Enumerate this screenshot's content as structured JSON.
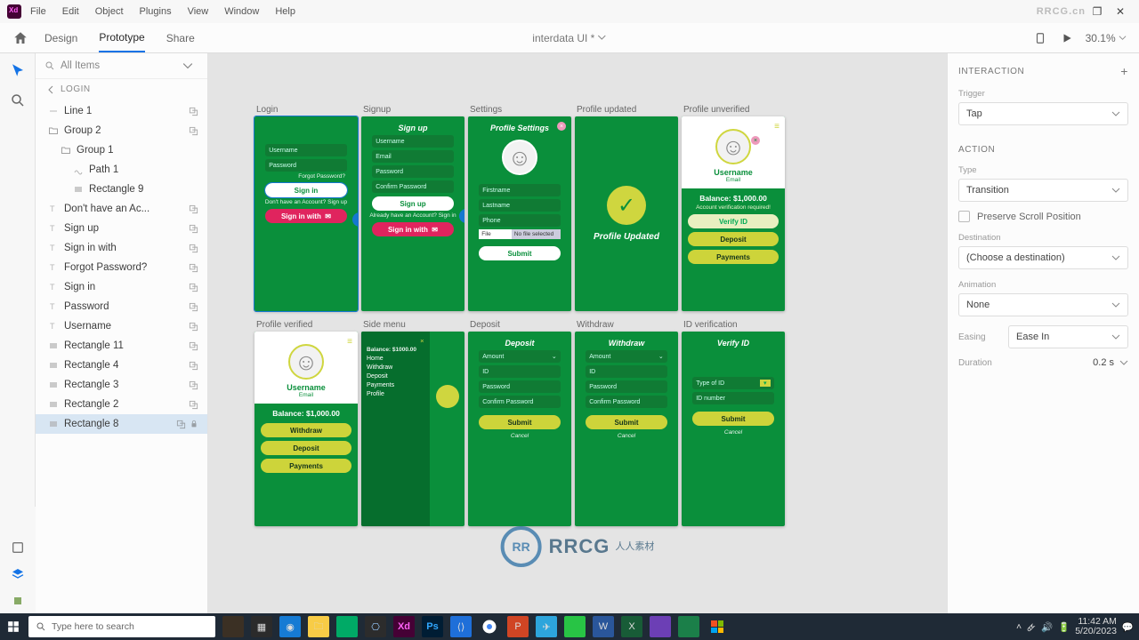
{
  "menubar": [
    "File",
    "Edit",
    "Object",
    "Plugins",
    "View",
    "Window",
    "Help"
  ],
  "watermark_tr": "RRCG.cn",
  "tabs": {
    "design": "Design",
    "prototype": "Prototype",
    "share": "Share"
  },
  "doc_title": "interdata UI *",
  "zoom": "30.1%",
  "left": {
    "search": "All Items",
    "back": "LOGIN",
    "layers": [
      {
        "name": "Line 1",
        "type": "line",
        "indent": 0,
        "link": true
      },
      {
        "name": "Group 2",
        "type": "folder",
        "indent": 0,
        "link": true
      },
      {
        "name": "Group 1",
        "type": "folder",
        "indent": 1
      },
      {
        "name": "Path 1",
        "type": "path",
        "indent": 2
      },
      {
        "name": "Rectangle 9",
        "type": "rect",
        "indent": 2
      },
      {
        "name": "Don't have an Ac...",
        "type": "text",
        "indent": 0,
        "link": true
      },
      {
        "name": "Sign up",
        "type": "text",
        "indent": 0,
        "link": true
      },
      {
        "name": "Sign in with",
        "type": "text",
        "indent": 0,
        "link": true
      },
      {
        "name": "Forgot Password?",
        "type": "text",
        "indent": 0,
        "link": true
      },
      {
        "name": "Sign in",
        "type": "text",
        "indent": 0,
        "link": true
      },
      {
        "name": "Password",
        "type": "text",
        "indent": 0,
        "link": true
      },
      {
        "name": "Username",
        "type": "text",
        "indent": 0,
        "link": true
      },
      {
        "name": "Rectangle 11",
        "type": "rect",
        "indent": 0,
        "link": true
      },
      {
        "name": "Rectangle 4",
        "type": "rect",
        "indent": 0,
        "link": true
      },
      {
        "name": "Rectangle 3",
        "type": "rect",
        "indent": 0,
        "link": true
      },
      {
        "name": "Rectangle 2",
        "type": "rect",
        "indent": 0,
        "link": true
      },
      {
        "name": "Rectangle 8",
        "type": "rect",
        "indent": 0,
        "selected": true,
        "link": true,
        "lock": true
      }
    ]
  },
  "artboards": {
    "login": {
      "label": "Login",
      "username": "Username",
      "password": "Password",
      "forgot": "Forgot Password?",
      "signin": "Sign in",
      "noacct": "Don't have an Account? Sign up",
      "signinwith": "Sign in with"
    },
    "signup": {
      "label": "Signup",
      "title": "Sign up",
      "username": "Username",
      "email": "Email",
      "password": "Password",
      "confirm": "Confirm Password",
      "button": "Sign up",
      "already": "Already have an Account? Sign in",
      "signinwith": "Sign in with"
    },
    "settings": {
      "label": "Settings",
      "title": "Profile Settings",
      "first": "Firstname",
      "last": "Lastname",
      "phone": "Phone",
      "file": "File",
      "nosel": "No file selected",
      "submit": "Submit"
    },
    "updated": {
      "label": "Profile updated",
      "msg": "Profile Updated"
    },
    "unverified": {
      "label": "Profile unverified",
      "user": "Username",
      "email": "Email",
      "balance": "Balance: $1,000.00",
      "note": "Account verification required!",
      "verify": "Verify ID",
      "deposit": "Deposit",
      "payments": "Payments"
    },
    "verified": {
      "label": "Profile verified",
      "user": "Username",
      "email": "Email",
      "balance": "Balance: $1,000.00",
      "withdraw": "Withdraw",
      "deposit": "Deposit",
      "payments": "Payments"
    },
    "sidemenu": {
      "label": "Side menu",
      "balance": "Balance: $1000.00",
      "items": [
        "Home",
        "Withdraw",
        "Deposit",
        "Payments",
        "Profile"
      ]
    },
    "deposit": {
      "label": "Deposit",
      "title": "Deposit",
      "amount": "Amount",
      "id": "ID",
      "password": "Password",
      "confirm": "Confirm Password",
      "submit": "Submit",
      "cancel": "Cancel"
    },
    "withdraw": {
      "label": "Withdraw",
      "title": "Withdraw",
      "amount": "Amount",
      "id": "ID",
      "password": "Password",
      "confirm": "Confirm Password",
      "submit": "Submit",
      "cancel": "Cancel"
    },
    "idverify": {
      "label": "ID verification",
      "title": "Verify ID",
      "type": "Type of ID",
      "idnum": "ID number",
      "submit": "Submit",
      "cancel": "Cancel"
    }
  },
  "right": {
    "interaction": "INTERACTION",
    "trigger_l": "Trigger",
    "trigger": "Tap",
    "action": "ACTION",
    "type_l": "Type",
    "type": "Transition",
    "preserve": "Preserve Scroll Position",
    "dest_l": "Destination",
    "dest": "(Choose a destination)",
    "anim_l": "Animation",
    "anim": "None",
    "easing_l": "Easing",
    "easing": "Ease In",
    "dur_l": "Duration",
    "dur": "0.2 s"
  },
  "taskbar": {
    "search": "Type here to search",
    "time": "11:42 AM",
    "date": "5/20/2023"
  },
  "bigwm": "RRCG"
}
